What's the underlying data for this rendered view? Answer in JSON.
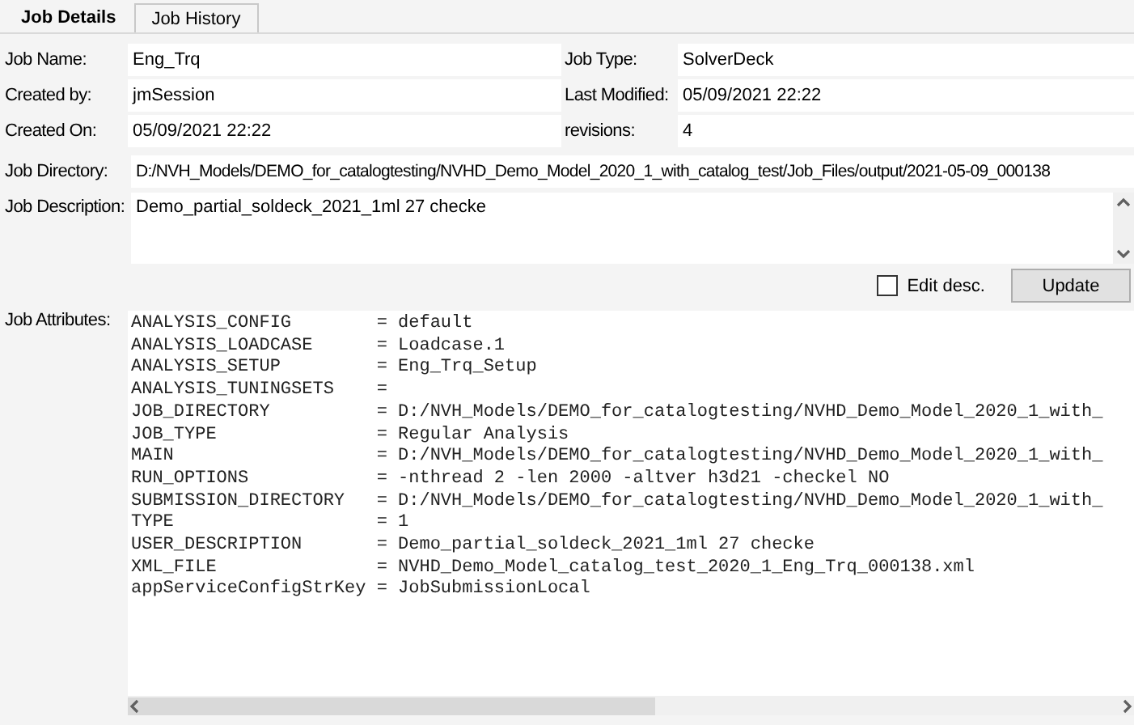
{
  "tabs": [
    {
      "label": "Job Details",
      "selected": true
    },
    {
      "label": "Job History",
      "selected": false
    }
  ],
  "fields": [
    {
      "label": "Job Name:",
      "value": "Eng_Trq"
    },
    {
      "label": "Job Type:",
      "value": "SolverDeck"
    },
    {
      "label": "Created by:",
      "value": "jmSession"
    },
    {
      "label": "Last Modified:",
      "value": "05/09/2021 22:22"
    },
    {
      "label": "Created On:",
      "value": "05/09/2021 22:22"
    },
    {
      "label": "revisions:",
      "value": "4"
    }
  ],
  "job_directory": {
    "label": "Job Directory:",
    "value": "D:/NVH_Models/DEMO_for_catalogtesting/NVHD_Demo_Model_2020_1_with_catalog_test/Job_Files/output/2021-05-09_000138"
  },
  "job_description": {
    "label": "Job Description:",
    "value": "Demo_partial_soldeck_2021_1ml 27 checke"
  },
  "edit_desc": {
    "label": "Edit desc.",
    "checked": false
  },
  "update_button": "Update",
  "job_attributes": {
    "label": "Job Attributes:",
    "lines": [
      "ANALYSIS_CONFIG        = default",
      "ANALYSIS_LOADCASE      = Loadcase.1",
      "ANALYSIS_SETUP         = Eng_Trq_Setup",
      "ANALYSIS_TUNINGSETS    =",
      "JOB_DIRECTORY          = D:/NVH_Models/DEMO_for_catalogtesting/NVHD_Demo_Model_2020_1_with_",
      "JOB_TYPE               = Regular Analysis",
      "MAIN                   = D:/NVH_Models/DEMO_for_catalogtesting/NVHD_Demo_Model_2020_1_with_",
      "RUN_OPTIONS            = -nthread 2 -len 2000 -altver h3d21 -checkel NO",
      "SUBMISSION_DIRECTORY   = D:/NVH_Models/DEMO_for_catalogtesting/NVHD_Demo_Model_2020_1_with_",
      "TYPE                   = 1",
      "USER_DESCRIPTION       = Demo_partial_soldeck_2021_1ml 27 checke",
      "XML_FILE               = NVHD_Demo_Model_catalog_test_2020_1_Eng_Trq_000138.xml",
      "appServiceConfigStrKey = JobSubmissionLocal"
    ]
  }
}
